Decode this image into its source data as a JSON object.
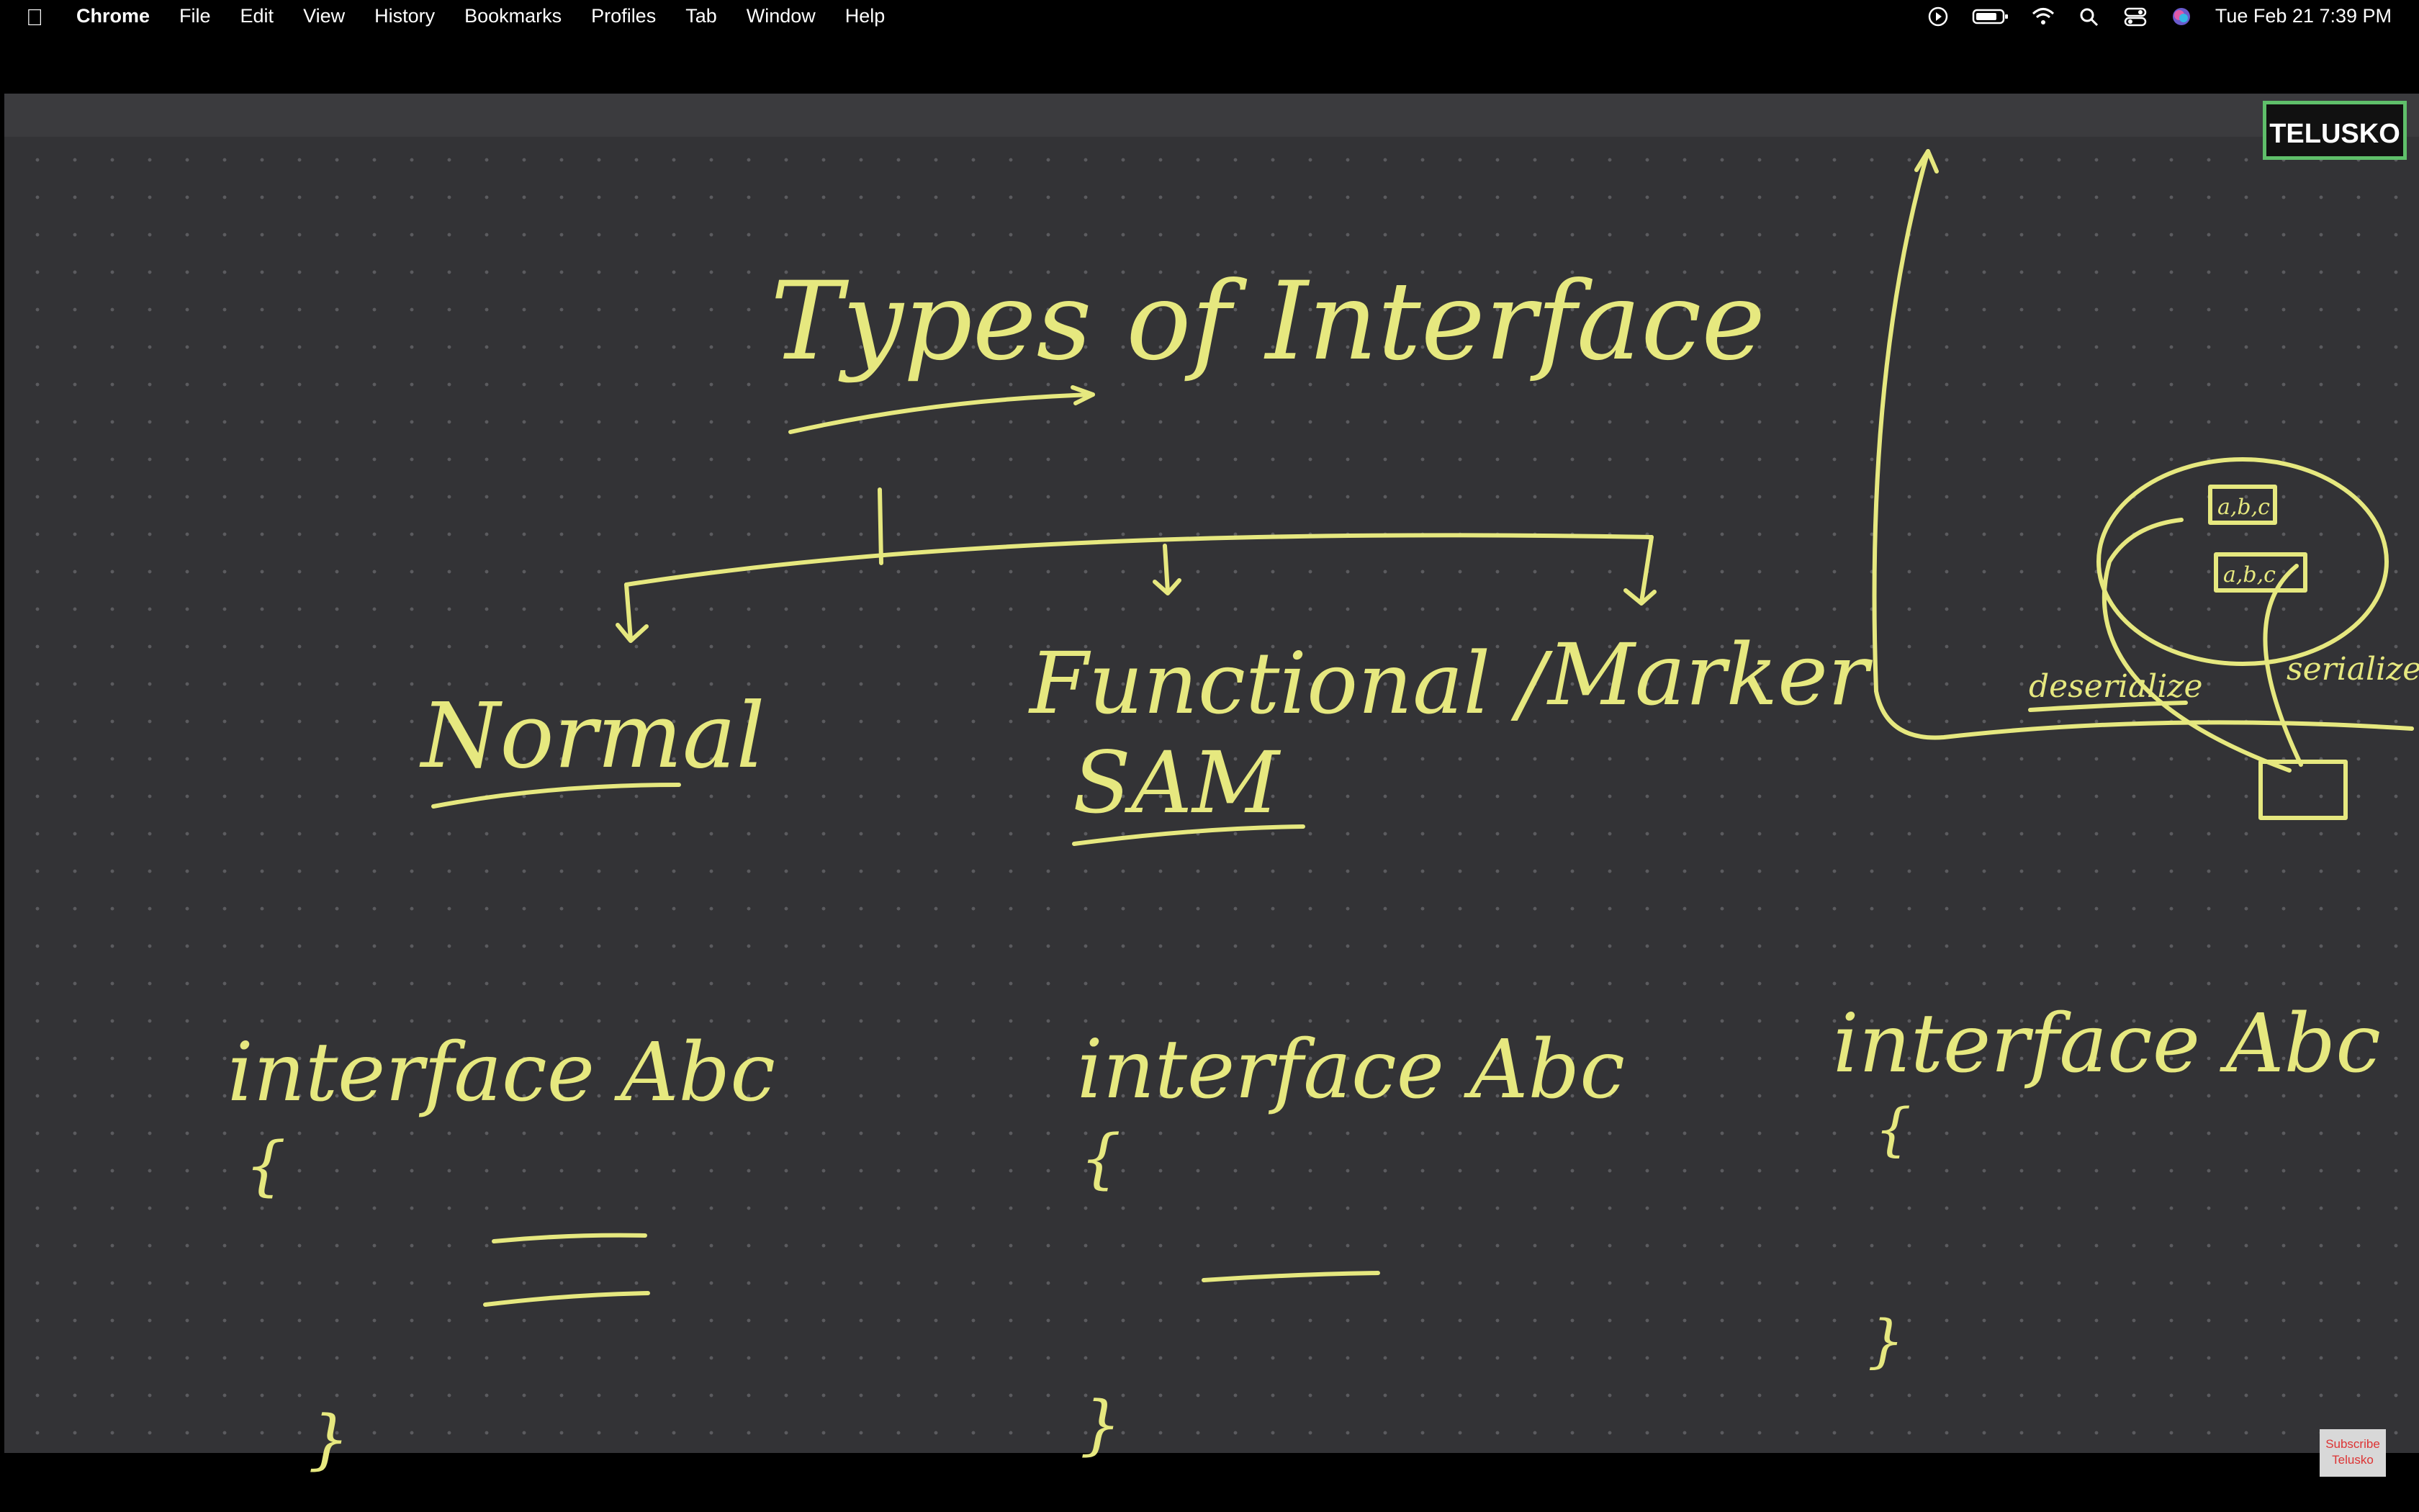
{
  "menubar": {
    "apple_icon": "apple-icon",
    "app_name": "Chrome",
    "menus": [
      "File",
      "Edit",
      "View",
      "History",
      "Bookmarks",
      "Profiles",
      "Tab",
      "Window",
      "Help"
    ],
    "status_icons": [
      "play-circle-icon",
      "battery-icon",
      "wifi-icon",
      "search-icon",
      "control-center-icon",
      "siri-icon"
    ],
    "clock": "Tue Feb 21  7:39 PM"
  },
  "video": {
    "logo": "TELUSKO",
    "subscribe_line1": "Subscribe",
    "subscribe_line2": "Telusko"
  },
  "whiteboard": {
    "title": "Types of Interface",
    "branches": [
      "Normal",
      "Functional /",
      "SAM",
      "Marker"
    ],
    "code_normal": "interface Abc",
    "code_functional": "interface Abc",
    "code_marker": "interface Abc",
    "brace_open": "{",
    "brace_close": "}",
    "side_sketch_label_left": "deserialize",
    "side_sketch_label_right": "serialize",
    "side_sketch_box1": "a,b,c",
    "side_sketch_box2": "a,b,c"
  }
}
